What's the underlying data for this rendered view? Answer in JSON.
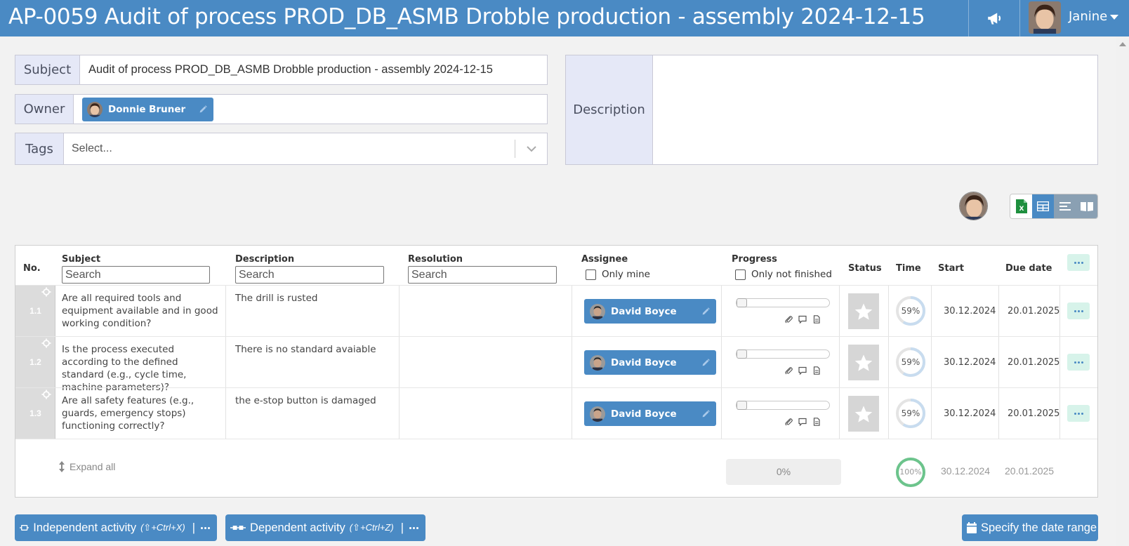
{
  "header": {
    "title": "AP-0059 Audit of process PROD_DB_ASMB Drobble production - assembly 2024-12-15",
    "user_name": "Janine",
    "icons": {
      "announcement": "megaphone-icon",
      "user_menu": "chevron-down-icon"
    }
  },
  "form": {
    "subject_label": "Subject",
    "subject_value": "Audit of process PROD_DB_ASMB Drobble production - assembly 2024-12-15",
    "owner_label": "Owner",
    "owner_name": "Donnie Bruner",
    "tags_label": "Tags",
    "tags_placeholder": "Select...",
    "description_label": "Description",
    "description_value": ""
  },
  "view_toolbar": {
    "buttons": [
      "excel-export-icon",
      "table-view-icon",
      "list-view-icon",
      "book-view-icon"
    ],
    "active": "table-view-icon"
  },
  "table": {
    "headers": {
      "no": "No.",
      "subject": "Subject",
      "description": "Description",
      "resolution": "Resolution",
      "assignee": "Assignee",
      "progress": "Progress",
      "status": "Status",
      "time": "Time",
      "start": "Start",
      "due": "Due date"
    },
    "search_placeholder": "Search",
    "only_mine_label": "Only mine",
    "only_not_finished_label": "Only not finished",
    "rows": [
      {
        "no": "1.1",
        "subject": "Are all required tools and equipment available and in good working condition?",
        "description": "The drill is rusted",
        "resolution": "",
        "assignee": "David Boyce",
        "progress": 0,
        "time_pct": "59%",
        "time_fraction": 0.59,
        "start": "30.12.2024",
        "due": "20.01.2025"
      },
      {
        "no": "1.2",
        "subject": "Is the process executed according to the defined standard (e.g., cycle time, machine parameters)?",
        "description": "There is no standard avaiable",
        "resolution": "",
        "assignee": "David Boyce",
        "progress": 0,
        "time_pct": "59%",
        "time_fraction": 0.59,
        "start": "30.12.2024",
        "due": "20.01.2025"
      },
      {
        "no": "1.3",
        "subject": "Are all safety features (e.g., guards, emergency stops) functioning correctly?",
        "description": "the e-stop button is damaged",
        "resolution": "",
        "assignee": "David Boyce",
        "progress": 0,
        "time_pct": "59%",
        "time_fraction": 0.59,
        "start": "30.12.2024",
        "due": "20.01.2025"
      }
    ],
    "footer": {
      "expand_all": "Expand all",
      "total_progress": "0%",
      "time_pct": "100%",
      "time_fraction": 1.0,
      "start": "30.12.2024",
      "due": "20.01.2025"
    }
  },
  "bottom": {
    "independent_label": "Independent activity",
    "independent_shortcut": "(⇧+Ctrl+X)",
    "dependent_label": "Dependent activity",
    "dependent_shortcut": "(⇧+Ctrl+Z)",
    "pipe": "|",
    "date_range_label": "Specify the date range"
  },
  "colors": {
    "accent": "#4a8ac4",
    "label_bg": "#e5e8f7",
    "ring_partial": "#c8dcef",
    "ring_complete": "#6cc48c",
    "action_bg": "#d7f3ea"
  }
}
